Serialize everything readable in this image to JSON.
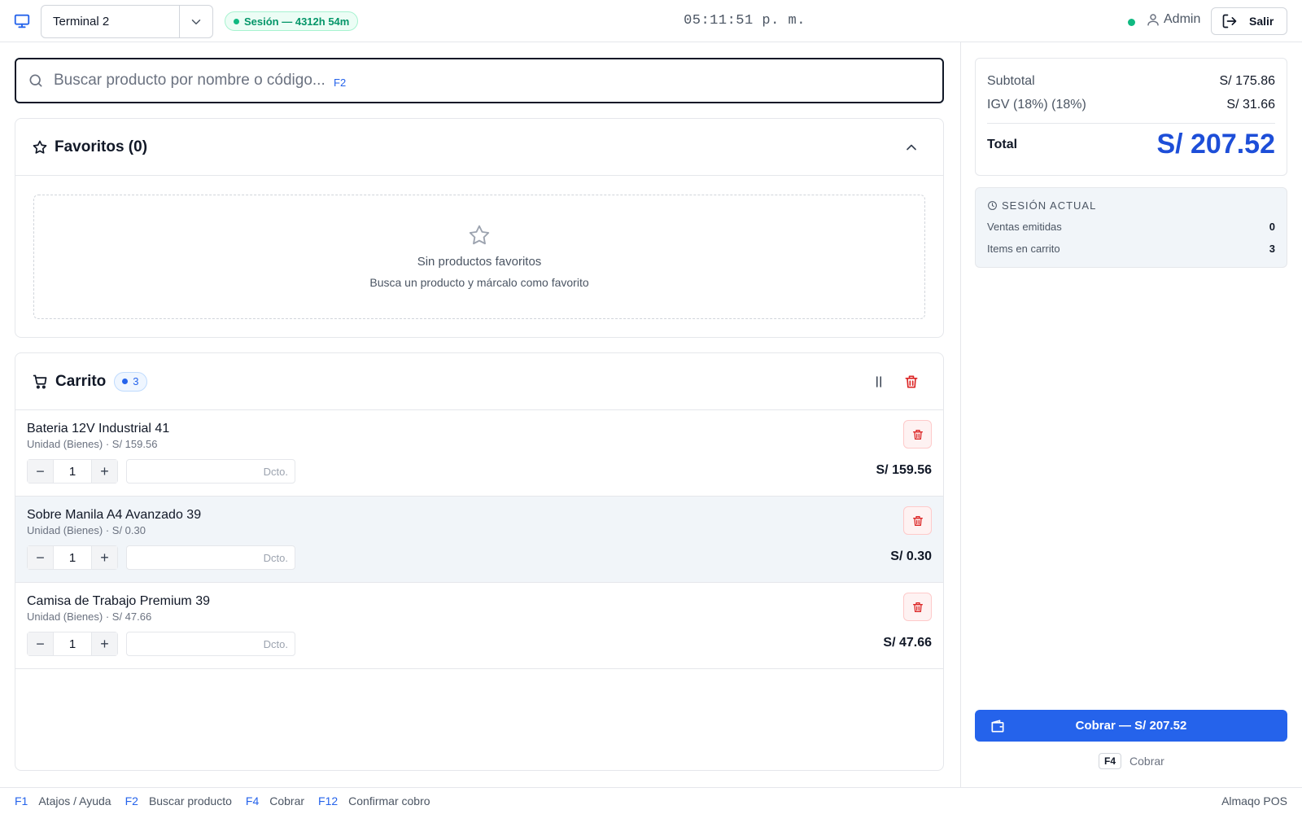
{
  "header": {
    "terminal": "Terminal 2",
    "session": "Sesión — 4312h 54m",
    "clock": "05:11:51 p. m.",
    "user": "Admin",
    "logout": "Salir"
  },
  "search": {
    "placeholder": "Buscar producto por nombre o código...",
    "shortcut": "F2"
  },
  "favorites": {
    "title": "Favoritos (0)",
    "empty_title": "Sin productos favoritos",
    "empty_hint": "Busca un producto y márcalo como favorito"
  },
  "cart": {
    "title": "Carrito",
    "count": "3",
    "discount_placeholder": "Dcto.",
    "items": [
      {
        "name": "Bateria 12V Industrial 41",
        "sub": "Unidad (Bienes) · S/ 159.56",
        "qty": "1",
        "total": "S/ 159.56"
      },
      {
        "name": "Sobre Manila A4 Avanzado 39",
        "sub": "Unidad (Bienes) · S/ 0.30",
        "qty": "1",
        "total": "S/ 0.30"
      },
      {
        "name": "Camisa de Trabajo Premium 39",
        "sub": "Unidad (Bienes) · S/ 47.66",
        "qty": "1",
        "total": "S/ 47.66"
      }
    ]
  },
  "totals": {
    "subtotal_label": "Subtotal",
    "subtotal": "S/ 175.86",
    "igv_label": "IGV (18%) (18%)",
    "igv": "S/ 31.66",
    "total_label": "Total",
    "total": "S/ 207.52"
  },
  "session_panel": {
    "title": "SESIÓN ACTUAL",
    "sales_label": "Ventas emitidas",
    "sales": "0",
    "items_label": "Items en carrito",
    "items": "3"
  },
  "pay": {
    "button": "Cobrar — S/ 207.52",
    "hint_key": "F4",
    "hint_label": "Cobrar"
  },
  "footer": {
    "shortcuts": [
      {
        "key": "F1",
        "label": "Atajos / Ayuda"
      },
      {
        "key": "F2",
        "label": "Buscar producto"
      },
      {
        "key": "F4",
        "label": "Cobrar"
      },
      {
        "key": "F12",
        "label": "Confirmar cobro"
      }
    ],
    "brand": "Almaqo POS"
  },
  "colors": {
    "accent": "#2563eb",
    "total": "#1d4ed8",
    "success": "#10b981",
    "danger": "#dc2626"
  }
}
